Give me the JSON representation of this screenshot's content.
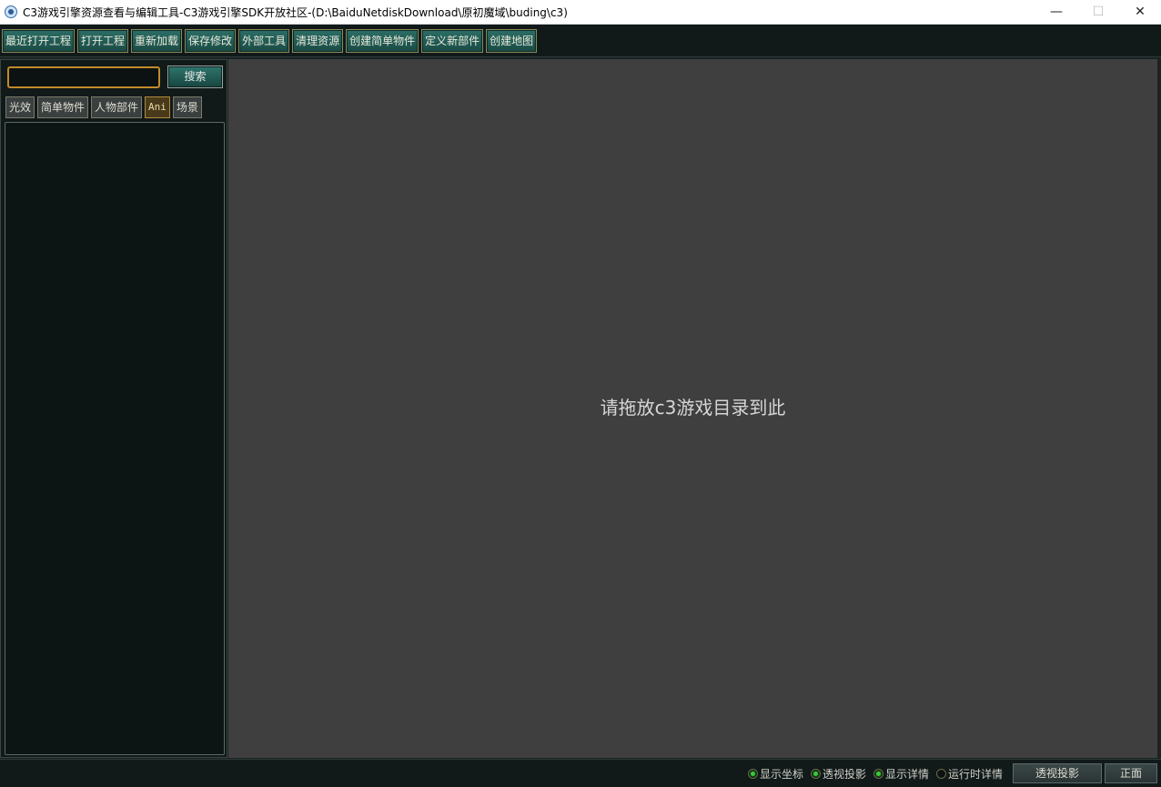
{
  "window": {
    "title": "C3游戏引擎资源查看与编辑工具-C3游戏引擎SDK开放社区-(D:\\BaiduNetdiskDownload\\原初魔域\\buding\\c3)",
    "minimize": "—",
    "maximize": "☐",
    "close": "✕"
  },
  "toolbar": {
    "buttons": [
      "最近打开工程",
      "打开工程",
      "重新加载",
      "保存修改",
      "外部工具",
      "清理资源",
      "创建简单物件",
      "定义新部件",
      "创建地图"
    ]
  },
  "left_panel": {
    "search_value": "",
    "search_label": "搜索",
    "tabs": [
      "光效",
      "简单物件",
      "人物部件",
      "Ani",
      "场景"
    ],
    "active_tab": "Ani"
  },
  "viewport": {
    "hint": "请拖放c3游戏目录到此"
  },
  "statusbar": {
    "radios": [
      {
        "label": "显示坐标",
        "checked": true
      },
      {
        "label": "透视投影",
        "checked": true
      },
      {
        "label": "显示详情",
        "checked": true
      },
      {
        "label": "运行时详情",
        "checked": false
      }
    ],
    "projection_button": "透视投影",
    "view_button": "正面"
  }
}
